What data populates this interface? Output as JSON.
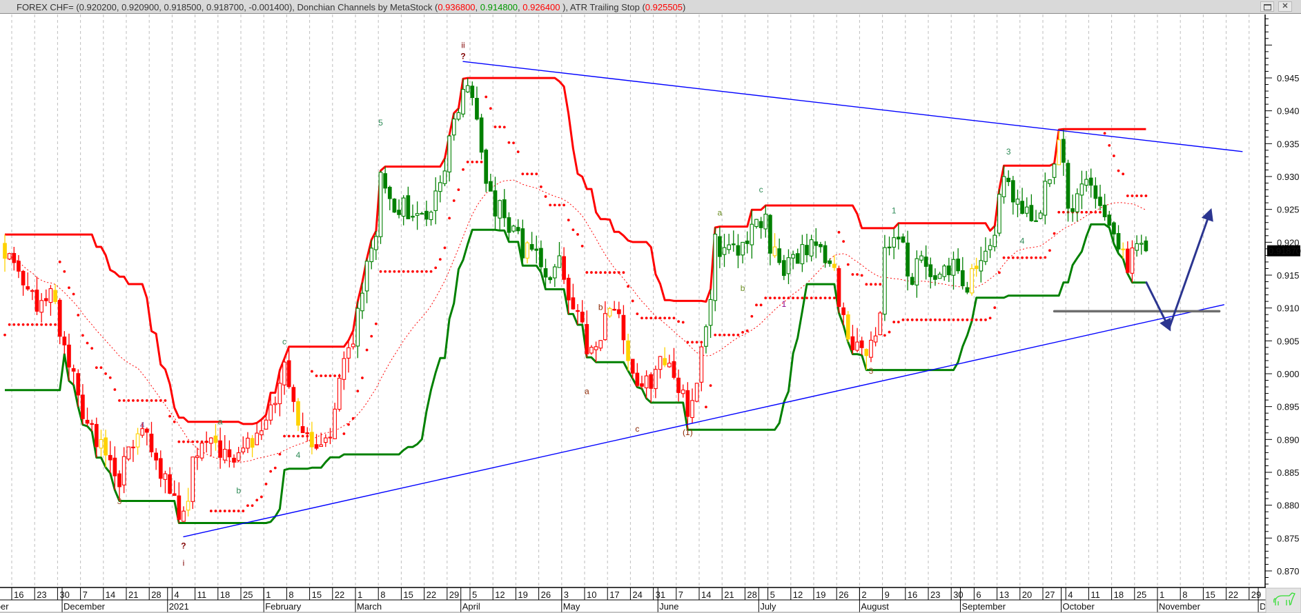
{
  "title": {
    "segments": [
      {
        "text": "FOREX CHF= (0.920200, 0.920900, 0.918500, 0.918700, -0.001400), Donchian Channels by MetaStock (",
        "color": "#333333"
      },
      {
        "text": "0.936800",
        "color": "#ff0000"
      },
      {
        "text": ", ",
        "color": "#333333"
      },
      {
        "text": "0.914800",
        "color": "#009900"
      },
      {
        "text": ", ",
        "color": "#333333"
      },
      {
        "text": "0.926400",
        "color": "#ff0000"
      },
      {
        "text": " ), ATR Trailing Stop (",
        "color": "#333333"
      },
      {
        "text": "0.925505",
        "color": "#ff0000"
      },
      {
        "text": ")",
        "color": "#333333"
      }
    ],
    "close_button": "✕"
  },
  "price_axis": {
    "labels": [
      "0.870",
      "0.875",
      "0.880",
      "0.885",
      "0.890",
      "0.895",
      "0.900",
      "0.905",
      "0.910",
      "0.915",
      "0.920",
      "0.925",
      "0.930",
      "0.935",
      "0.940",
      "0.945"
    ],
    "current_price_label": "0.91870",
    "current_price": 0.9187
  },
  "time_axis": {
    "week_labels": [
      "16",
      "23",
      "30",
      "7",
      "14",
      "21",
      "28",
      "4",
      "11",
      "18",
      "25",
      "1",
      "8",
      "15",
      "22",
      "1",
      "8",
      "15",
      "22",
      "29",
      "5",
      "12",
      "19",
      "26",
      "3",
      "10",
      "17",
      "24",
      "31",
      "7",
      "14",
      "21",
      "28",
      "5",
      "12",
      "19",
      "26",
      "2",
      "9",
      "16",
      "23",
      "30",
      "6",
      "13",
      "20",
      "27",
      "4",
      "11",
      "18",
      "25",
      "1",
      "8",
      "15",
      "22",
      "29"
    ],
    "first_week": "2020-11-16",
    "months": [
      {
        "label": "November",
        "start": "2020-11-02"
      },
      {
        "label": "December",
        "start": "2020-12-01"
      },
      {
        "label": "2021",
        "start": "2021-01-01"
      },
      {
        "label": "February",
        "start": "2021-02-01"
      },
      {
        "label": "March",
        "start": "2021-03-01"
      },
      {
        "label": "April",
        "start": "2021-04-01"
      },
      {
        "label": "May",
        "start": "2021-05-03"
      },
      {
        "label": "June",
        "start": "2021-06-01"
      },
      {
        "label": "July",
        "start": "2021-07-01"
      },
      {
        "label": "August",
        "start": "2021-08-02"
      },
      {
        "label": "September",
        "start": "2021-09-01"
      },
      {
        "label": "October",
        "start": "2021-10-01"
      },
      {
        "label": "November",
        "start": "2021-11-01"
      },
      {
        "label": "December",
        "start": "2021-12-01"
      }
    ]
  },
  "chart_data": {
    "type": "candlestick",
    "symbol": "FOREX CHF=",
    "ylim": [
      0.8675,
      0.9548
    ],
    "grid": "vertical-weekly-dashed",
    "last_bar": {
      "date": "2021-10-27",
      "open": 0.9202,
      "high": 0.9209,
      "low": 0.9185,
      "close": 0.9187
    },
    "close_path": [
      [
        "2020-11-12",
        0.9185
      ],
      [
        "2020-11-13",
        0.917
      ],
      [
        "2020-11-18",
        0.914
      ],
      [
        "2020-11-23",
        0.911
      ],
      [
        "2020-11-26",
        0.913
      ],
      [
        "2020-11-30",
        0.905
      ],
      [
        "2020-12-03",
        0.899
      ],
      [
        "2020-12-08",
        0.893
      ],
      [
        "2020-12-11",
        0.889
      ],
      [
        "2020-12-17",
        0.8845
      ],
      [
        "2020-12-21",
        0.89
      ],
      [
        "2020-12-24",
        0.891
      ],
      [
        "2020-12-29",
        0.887
      ],
      [
        "2021-01-04",
        0.88
      ],
      [
        "2021-01-06",
        0.8775
      ],
      [
        "2021-01-08",
        0.886
      ],
      [
        "2021-01-12",
        0.889
      ],
      [
        "2021-01-15",
        0.89
      ],
      [
        "2021-01-20",
        0.886
      ],
      [
        "2021-01-25",
        0.889
      ],
      [
        "2021-01-29",
        0.89
      ],
      [
        "2021-02-03",
        0.897
      ],
      [
        "2021-02-05",
        0.902
      ],
      [
        "2021-02-09",
        0.895
      ],
      [
        "2021-02-12",
        0.89
      ],
      [
        "2021-02-17",
        0.89
      ],
      [
        "2021-02-22",
        0.895
      ],
      [
        "2021-02-25",
        0.904
      ],
      [
        "2021-03-01",
        0.91
      ],
      [
        "2021-03-04",
        0.92
      ],
      [
        "2021-03-08",
        0.929
      ],
      [
        "2021-03-10",
        0.926
      ],
      [
        "2021-03-16",
        0.925
      ],
      [
        "2021-03-22",
        0.922
      ],
      [
        "2021-03-25",
        0.929
      ],
      [
        "2021-03-29",
        0.935
      ],
      [
        "2021-04-01",
        0.944
      ],
      [
        "2021-04-05",
        0.941
      ],
      [
        "2021-04-07",
        0.933
      ],
      [
        "2021-04-09",
        0.928
      ],
      [
        "2021-04-14",
        0.924
      ],
      [
        "2021-04-19",
        0.92
      ],
      [
        "2021-04-23",
        0.917
      ],
      [
        "2021-04-28",
        0.916
      ],
      [
        "2021-04-30",
        0.918
      ],
      [
        "2021-05-05",
        0.911
      ],
      [
        "2021-05-10",
        0.902
      ],
      [
        "2021-05-14",
        0.908
      ],
      [
        "2021-05-18",
        0.91
      ],
      [
        "2021-05-21",
        0.902
      ],
      [
        "2021-05-26",
        0.897
      ],
      [
        "2021-05-28",
        0.899
      ],
      [
        "2021-06-02",
        0.902
      ],
      [
        "2021-06-07",
        0.898
      ],
      [
        "2021-06-09",
        0.894
      ],
      [
        "2021-06-11",
        0.899
      ],
      [
        "2021-06-15",
        0.906
      ],
      [
        "2021-06-17",
        0.92
      ],
      [
        "2021-06-22",
        0.918
      ],
      [
        "2021-06-25",
        0.919
      ],
      [
        "2021-06-30",
        0.923
      ],
      [
        "2021-07-02",
        0.925
      ],
      [
        "2021-07-07",
        0.916
      ],
      [
        "2021-07-12",
        0.918
      ],
      [
        "2021-07-16",
        0.92
      ],
      [
        "2021-07-21",
        0.918
      ],
      [
        "2021-07-26",
        0.912
      ],
      [
        "2021-07-28",
        0.906
      ],
      [
        "2021-08-02",
        0.903
      ],
      [
        "2021-08-05",
        0.904
      ],
      [
        "2021-08-09",
        0.918
      ],
      [
        "2021-08-12",
        0.922
      ],
      [
        "2021-08-17",
        0.915
      ],
      [
        "2021-08-20",
        0.918
      ],
      [
        "2021-08-25",
        0.914
      ],
      [
        "2021-08-30",
        0.917
      ],
      [
        "2021-09-02",
        0.914
      ],
      [
        "2021-09-07",
        0.918
      ],
      [
        "2021-09-10",
        0.922
      ],
      [
        "2021-09-14",
        0.931
      ],
      [
        "2021-09-17",
        0.926
      ],
      [
        "2021-09-22",
        0.923
      ],
      [
        "2021-09-27",
        0.929
      ],
      [
        "2021-09-30",
        0.934
      ],
      [
        "2021-10-04",
        0.925
      ],
      [
        "2021-10-07",
        0.928
      ],
      [
        "2021-10-12",
        0.928
      ],
      [
        "2021-10-14",
        0.924
      ],
      [
        "2021-10-18",
        0.921
      ],
      [
        "2021-10-21",
        0.916
      ],
      [
        "2021-10-22",
        0.919
      ],
      [
        "2021-10-26",
        0.9202
      ]
    ],
    "noise_seed": 7,
    "regimes": [
      {
        "from": "2020-11-01",
        "to": "2021-02-26",
        "color": "#ff0000"
      },
      {
        "from": "2021-03-01",
        "to": "2021-04-30",
        "color": "#008000"
      },
      {
        "from": "2021-05-03",
        "to": "2021-06-14",
        "color": "#ff0000"
      },
      {
        "from": "2021-06-15",
        "to": "2021-07-23",
        "color": "#008000"
      },
      {
        "from": "2021-07-26",
        "to": "2021-08-06",
        "color": "#ff0000"
      },
      {
        "from": "2021-08-09",
        "to": "2021-10-19",
        "color": "#008000"
      },
      {
        "from": "2021-10-20",
        "to": "2021-10-22",
        "color": "#ff0000"
      },
      {
        "from": "2021-10-25",
        "to": "2021-12-31",
        "color": "#008000"
      }
    ],
    "neutral_color": "#ffd200",
    "indicators": {
      "donchian": {
        "period": 20,
        "initial_upper": 0.9207,
        "initial_lower": 0.8975,
        "prehistory_bars": 13,
        "upper_color": "#ff0000",
        "lower_color": "#008000",
        "value_upper": 0.9368,
        "value_lower": 0.9148,
        "value_mid": 0.9264
      },
      "moving_average": {
        "period": 30,
        "color": "#ff0000"
      },
      "atr_trailing_stop": {
        "period": 10,
        "factor": 2.8,
        "initial_stop": 0.9005,
        "color": "#ff0000",
        "value": 0.925505
      }
    },
    "trendlines": [
      {
        "name": "lower-trendline",
        "from": [
          "2021-01-06",
          0.8752
        ],
        "to": [
          "2021-11-19",
          0.9105
        ],
        "color": "#0000ff"
      },
      {
        "name": "upper-trendline",
        "from": [
          "2021-04-01",
          0.9475
        ],
        "to": [
          "2021-11-25",
          0.9338
        ],
        "color": "#0000ff"
      },
      {
        "name": "support-line",
        "from": [
          "2021-09-29",
          0.9095
        ],
        "to": [
          "2021-11-18",
          0.9095
        ],
        "color": "#6e6e6e"
      }
    ],
    "arrows": [
      {
        "name": "projection-down-arrow",
        "from": [
          "2021-10-27",
          0.914
        ],
        "to": [
          "2021-11-03",
          0.907
        ],
        "color": "#2b3590"
      },
      {
        "name": "projection-up-arrow",
        "from": [
          "2021-11-03",
          0.9068
        ],
        "to": [
          "2021-11-16",
          0.9246
        ],
        "color": "#2b3590"
      }
    ],
    "wave_labels": [
      {
        "text": "3",
        "date": "2020-12-17",
        "price": 0.8806,
        "color": "#a0522d"
      },
      {
        "text": "4",
        "date": "2020-12-24",
        "price": 0.8922,
        "color": "#7b5ea7"
      },
      {
        "text": "?",
        "date": "2021-01-06",
        "price": 0.8738,
        "color": "#800000",
        "big": true
      },
      {
        "text": "i",
        "date": "2021-01-06",
        "price": 0.8712,
        "color": "#800000"
      },
      {
        "text": "a",
        "date": "2021-01-18",
        "price": 0.8927,
        "color": "#2e8b57"
      },
      {
        "text": "b",
        "date": "2021-01-22",
        "price": 0.8822,
        "color": "#2e8b57"
      },
      {
        "text": "c",
        "date": "2021-02-05",
        "price": 0.9049,
        "color": "#2e8b57"
      },
      {
        "text": "4",
        "date": "2021-02-10",
        "price": 0.8876,
        "color": "#2e8b57"
      },
      {
        "text": "5",
        "date": "2021-03-08",
        "price": 0.9382,
        "color": "#2e8b57"
      },
      {
        "text": "ii",
        "date": "2021-04-01",
        "price": 0.95,
        "color": "#800000"
      },
      {
        "text": "?",
        "date": "2021-04-01",
        "price": 0.9483,
        "color": "#800000",
        "big": true
      },
      {
        "text": "a",
        "date": "2021-05-10",
        "price": 0.8973,
        "color": "#8b2500"
      },
      {
        "text": "b",
        "date": "2021-05-13",
        "price": 0.9101,
        "color": "#8b2500"
      },
      {
        "text": "c",
        "date": "2021-05-25",
        "price": 0.8916,
        "color": "#8b2500"
      },
      {
        "text": "(1)",
        "date": "2021-06-09",
        "price": 0.8911,
        "color": "#8b2500"
      },
      {
        "text": "a",
        "date": "2021-06-18",
        "price": 0.9245,
        "color": "#6b8e23"
      },
      {
        "text": "b",
        "date": "2021-06-25",
        "price": 0.913,
        "color": "#6b8e23"
      },
      {
        "text": "c",
        "date": "2021-07-01",
        "price": 0.928,
        "color": "#2e8b57"
      },
      {
        "text": "1",
        "date": "2021-07-08",
        "price": 0.9106,
        "color": "#8b008b"
      },
      {
        "text": "3",
        "date": "2021-08-04",
        "price": 0.9004,
        "color": "#a0522d"
      },
      {
        "text": "1",
        "date": "2021-08-11",
        "price": 0.9248,
        "color": "#2e8b57"
      },
      {
        "text": "3",
        "date": "2021-09-15",
        "price": 0.9338,
        "color": "#2e8b57"
      },
      {
        "text": "4",
        "date": "2021-09-20",
        "price": 0.9202,
        "color": "#2e8b57"
      }
    ]
  }
}
